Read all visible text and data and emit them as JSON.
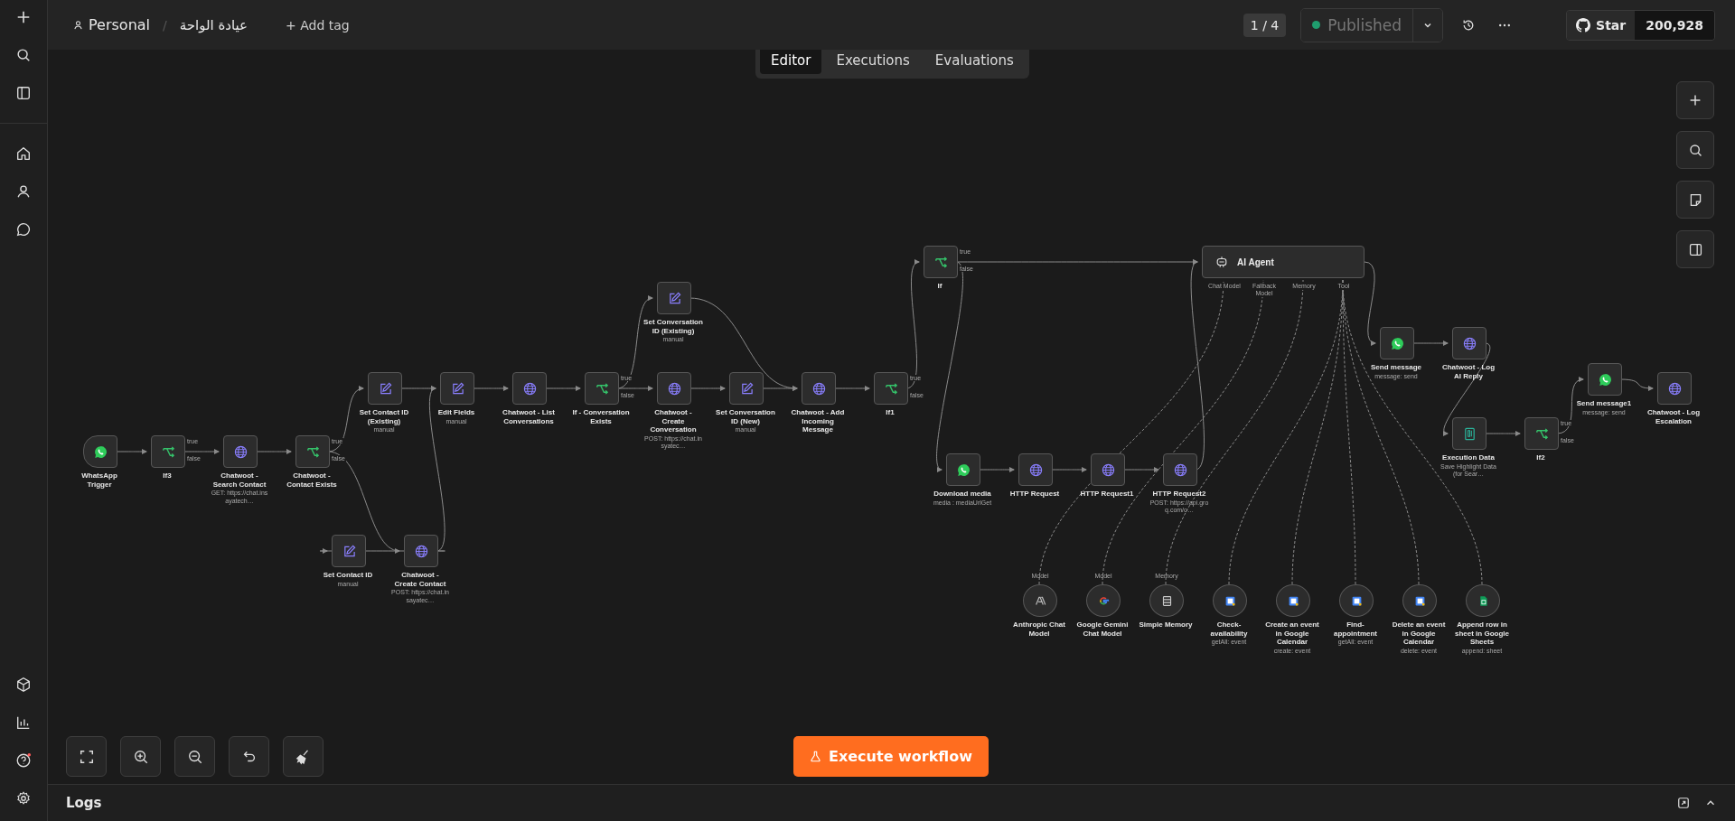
{
  "header": {
    "project": "Personal",
    "separator": "/",
    "workflow_name": "عيادة الواحة",
    "add_tag": "+ Add tag",
    "version": "1 / 4",
    "status": "Published",
    "published": true,
    "github": {
      "label": "Star",
      "count": "200,928"
    }
  },
  "tabs": [
    {
      "label": "Editor",
      "selected": true
    },
    {
      "label": "Executions",
      "selected": false
    },
    {
      "label": "Evaluations",
      "selected": false
    }
  ],
  "nodes": [
    {
      "kind": "trigger",
      "label": "WhatsApp Trigger"
    },
    {
      "kind": "if",
      "label": "If3",
      "outputs": [
        "true",
        "false"
      ]
    },
    {
      "kind": "http",
      "label": "Chatwoot - Search Contact",
      "subtitle": "GET: https://chat.insayatech…"
    },
    {
      "kind": "if",
      "label": "Chatwoot - Contact Exists",
      "outputs": [
        "true",
        "false"
      ]
    },
    {
      "kind": "set",
      "label": "Set Contact ID (Existing)",
      "subtitle": "manual"
    },
    {
      "kind": "set",
      "label": "Set Contact ID",
      "subtitle": "manual"
    },
    {
      "kind": "http",
      "label": "Chatwoot - Create Contact",
      "subtitle": "POST: https://chat.insayatec…"
    },
    {
      "kind": "set",
      "label": "Edit Fields",
      "subtitle": "manual"
    },
    {
      "kind": "http",
      "label": "Chatwoot - List Conversations"
    },
    {
      "kind": "if",
      "label": "If - Conversation Exists",
      "outputs": [
        "true",
        "false"
      ]
    },
    {
      "kind": "set",
      "label": "Set Conversation ID (Existing)",
      "subtitle": "manual"
    },
    {
      "kind": "http",
      "label": "Chatwoot - Create Conversation",
      "subtitle": "POST: https://chat.insyatec…"
    },
    {
      "kind": "set",
      "label": "Set Conversation ID (New)",
      "subtitle": "manual"
    },
    {
      "kind": "http",
      "label": "Chatwoot - Add Incoming Message"
    },
    {
      "kind": "if",
      "label": "If1",
      "outputs": [
        "true",
        "false"
      ]
    },
    {
      "kind": "if",
      "label": "If",
      "outputs": [
        "true",
        "false"
      ]
    },
    {
      "kind": "whatsapp",
      "label": "Download media",
      "subtitle": "media : mediaUrlGet"
    },
    {
      "kind": "http",
      "label": "HTTP Request"
    },
    {
      "kind": "http",
      "label": "HTTP Request1"
    },
    {
      "kind": "http",
      "label": "HTTP Request2",
      "subtitle": "POST: https://api.groq.com/o…"
    },
    {
      "kind": "agent",
      "label": "AI Agent",
      "inputs": [
        "Chat Model",
        "Fallback Model",
        "Memory",
        "Tool"
      ]
    },
    {
      "kind": "anthropic",
      "label": "Anthropic Chat Model",
      "port": "Model"
    },
    {
      "kind": "google",
      "label": "Google Gemini Chat Model",
      "port": "Model"
    },
    {
      "kind": "memory",
      "label": "Simple Memory",
      "port": "Memory"
    },
    {
      "kind": "calendar",
      "label": "Check-availability",
      "subtitle": "getAll: event"
    },
    {
      "kind": "calendar",
      "label": "Create an event in Google Calendar",
      "subtitle": "create: event"
    },
    {
      "kind": "calendar",
      "label": "Find-appointment",
      "subtitle": "getAll: event"
    },
    {
      "kind": "calendar",
      "label": "Delete an event in Google Calendar",
      "subtitle": "delete: event"
    },
    {
      "kind": "sheets",
      "label": "Append row in sheet in Google Sheets",
      "subtitle": "append: sheet"
    },
    {
      "kind": "whatsapp",
      "label": "Send message",
      "subtitle": "message: send"
    },
    {
      "kind": "http",
      "label": "Chatwoot - Log AI Reply"
    },
    {
      "kind": "data",
      "label": "Execution Data",
      "subtitle": "Save Highlight Data (for Sear…"
    },
    {
      "kind": "if",
      "label": "If2",
      "outputs": [
        "true",
        "false"
      ]
    },
    {
      "kind": "whatsapp",
      "label": "Send message1",
      "subtitle": "message: send"
    },
    {
      "kind": "http",
      "label": "Chatwoot - Log Escalation"
    }
  ],
  "execute_button": "Execute workflow",
  "logs": {
    "title": "Logs"
  }
}
